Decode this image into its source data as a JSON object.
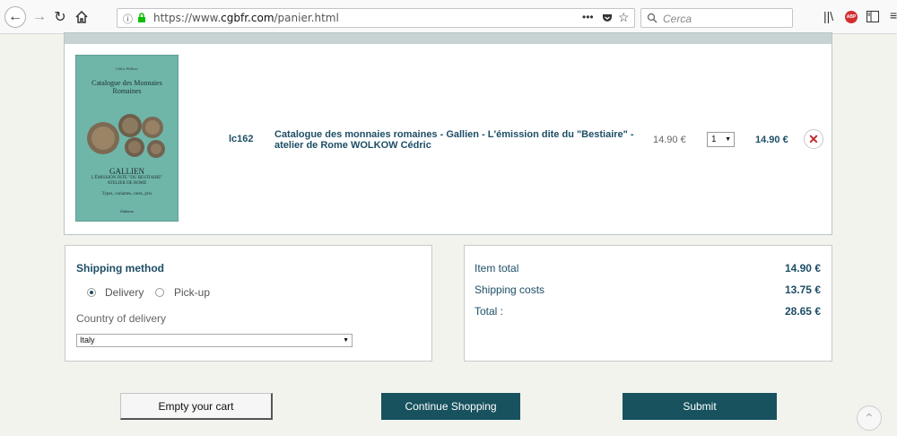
{
  "browser": {
    "url_prefix": "https://www.",
    "url_domain": "cgbfr.com",
    "url_path": "/panier.html",
    "search_placeholder": "Cerca"
  },
  "product": {
    "ref": "lc162",
    "title": "Catalogue des monnaies romaines - Gallien - L'émission dite du \"Bestiaire\" - atelier de Rome WOLKOW Cédric",
    "unit_price": "14.90 €",
    "quantity": "1",
    "line_total": "14.90 €",
    "cover": {
      "author": "Cédric Wolkow",
      "title_line1": "Catalogue des Monnaies",
      "title_line2": "Romaines",
      "sub1": "GALLIEN",
      "sub2": "L'ÉMISSION DITE \"DU BESTIAIRE\"",
      "sub3": "ATELIER DE ROME",
      "sub4": "Types, variantes, cotes, prix",
      "editor": "Éditions"
    }
  },
  "shipping": {
    "title": "Shipping method",
    "option_delivery": "Delivery",
    "option_pickup": "Pick-up",
    "selected": "delivery",
    "country_label": "Country of delivery",
    "country_value": "Italy"
  },
  "totals": {
    "item_total_label": "Item total",
    "item_total_value": "14.90 €",
    "shipping_label": "Shipping costs",
    "shipping_value": "13.75 €",
    "total_label": "Total :",
    "total_value": "28.65 €"
  },
  "buttons": {
    "empty_cart": "Empty your cart",
    "continue": "Continue Shopping",
    "submit": "Submit"
  },
  "colors": {
    "accent": "#17525e",
    "heading": "#1d4e66",
    "page_bg": "#f3f3ee",
    "cover_bg": "#6fb6a9"
  }
}
